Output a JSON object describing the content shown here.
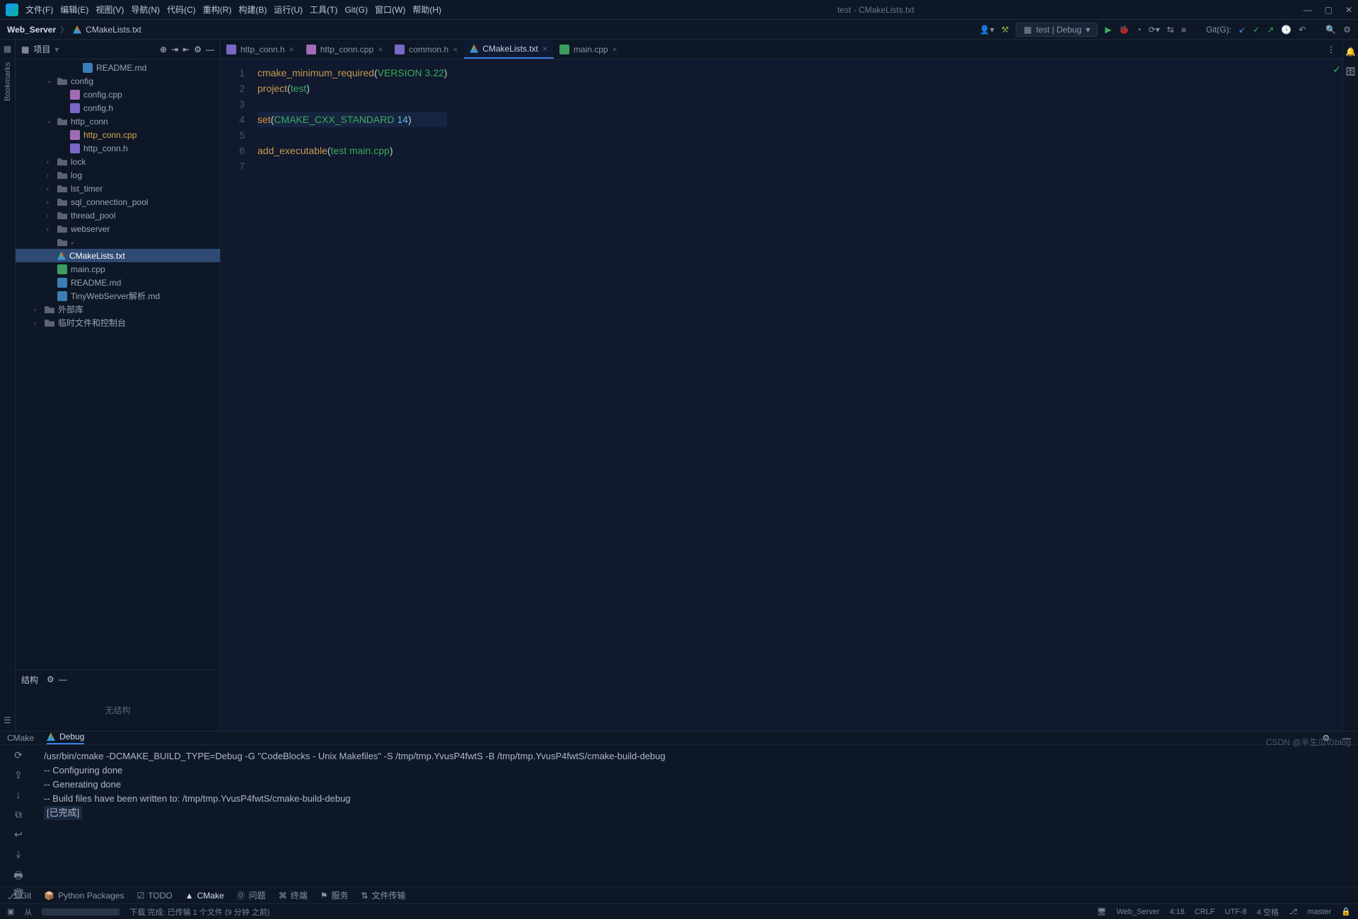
{
  "window": {
    "title": "test - CMakeLists.txt"
  },
  "menu": [
    "文件(F)",
    "编辑(E)",
    "视图(V)",
    "导航(N)",
    "代码(C)",
    "重构(R)",
    "构建(B)",
    "运行(U)",
    "工具(T)",
    "Git(G)",
    "窗口(W)",
    "帮助(H)"
  ],
  "breadcrumbs": {
    "root": "Web_Server",
    "file": "CMakeLists.txt"
  },
  "run_config": {
    "label": "test | Debug"
  },
  "vcs_label": "Git(G):",
  "project_panel": {
    "title": "项目"
  },
  "tree": [
    {
      "depth": 3,
      "icon": "md",
      "label": "README.md",
      "chv": ""
    },
    {
      "depth": 1,
      "icon": "folder",
      "label": "config",
      "chv": "v"
    },
    {
      "depth": 2,
      "icon": "cpp",
      "label": "config.cpp",
      "chv": ""
    },
    {
      "depth": 2,
      "icon": "h",
      "label": "config.h",
      "chv": ""
    },
    {
      "depth": 1,
      "icon": "folder",
      "label": "http_conn",
      "chv": "v"
    },
    {
      "depth": 2,
      "icon": "cpp",
      "label": "http_conn.cpp",
      "chv": "",
      "hl": true
    },
    {
      "depth": 2,
      "icon": "h",
      "label": "http_conn.h",
      "chv": ""
    },
    {
      "depth": 1,
      "icon": "folder",
      "label": "lock",
      "chv": ">"
    },
    {
      "depth": 1,
      "icon": "folder",
      "label": "log",
      "chv": ">"
    },
    {
      "depth": 1,
      "icon": "folder",
      "label": "lst_timer",
      "chv": ">"
    },
    {
      "depth": 1,
      "icon": "folder",
      "label": "sql_connection_pool",
      "chv": ">"
    },
    {
      "depth": 1,
      "icon": "folder",
      "label": "thread_pool",
      "chv": ">"
    },
    {
      "depth": 1,
      "icon": "folder",
      "label": "webserver",
      "chv": ">"
    },
    {
      "depth": 1,
      "icon": "txt",
      "label": "-",
      "chv": ""
    },
    {
      "depth": 1,
      "icon": "cmake",
      "label": "CMakeLists.txt",
      "chv": "",
      "sel": true
    },
    {
      "depth": 1,
      "icon": "main",
      "label": "main.cpp",
      "chv": ""
    },
    {
      "depth": 1,
      "icon": "md",
      "label": "README.md",
      "chv": ""
    },
    {
      "depth": 1,
      "icon": "md",
      "label": "TinyWebServer解析.md",
      "chv": ""
    },
    {
      "depth": 0,
      "icon": "lib",
      "label": "外部库",
      "chv": ">"
    },
    {
      "depth": 0,
      "icon": "scratch",
      "label": "临时文件和控制台",
      "chv": ">"
    }
  ],
  "structure": {
    "title": "结构",
    "empty": "无结构"
  },
  "tabs": [
    {
      "icon": "h",
      "label": "http_conn.h",
      "active": false
    },
    {
      "icon": "cpp",
      "label": "http_conn.cpp",
      "active": false
    },
    {
      "icon": "h",
      "label": "common.h",
      "active": false
    },
    {
      "icon": "cmake",
      "label": "CMakeLists.txt",
      "active": true
    },
    {
      "icon": "main",
      "label": "main.cpp",
      "active": false
    }
  ],
  "code": {
    "lines": [
      {
        "n": 1,
        "seg": [
          [
            "fn",
            "cmake_minimum_required"
          ],
          [
            "par",
            "("
          ],
          [
            "str",
            "VERSION 3.22"
          ],
          [
            "par",
            ")"
          ]
        ]
      },
      {
        "n": 2,
        "seg": [
          [
            "fn",
            "project"
          ],
          [
            "par",
            "("
          ],
          [
            "str",
            "test"
          ],
          [
            "par",
            ")"
          ]
        ]
      },
      {
        "n": 3,
        "seg": []
      },
      {
        "n": 4,
        "seg": [
          [
            "kw",
            "set"
          ],
          [
            "par",
            "("
          ],
          [
            "str",
            "CMAKE_CXX_STANDARD "
          ],
          [
            "num",
            "14"
          ],
          [
            "par",
            ")"
          ]
        ],
        "cur": true
      },
      {
        "n": 5,
        "seg": []
      },
      {
        "n": 6,
        "seg": [
          [
            "fn",
            "add_executable"
          ],
          [
            "par",
            "("
          ],
          [
            "str",
            "test main.cpp"
          ],
          [
            "par",
            ")"
          ]
        ]
      },
      {
        "n": 7,
        "seg": []
      }
    ]
  },
  "bottom": {
    "tabs": [
      "CMake",
      "Debug"
    ],
    "active": 1,
    "console": [
      "/usr/bin/cmake -DCMAKE_BUILD_TYPE=Debug -G \"CodeBlocks - Unix Makefiles\" -S /tmp/tmp.YvusP4fwtS -B /tmp/tmp.YvusP4fwtS/cmake-build-debug",
      "-- Configuring done",
      "-- Generating done",
      "-- Build files have been written to: /tmp/tmp.YvusP4fwtS/cmake-build-debug",
      "",
      "[已完成]"
    ]
  },
  "tool_windows": [
    "Git",
    "Python Packages",
    "TODO",
    "CMake",
    "问题",
    "终端",
    "服务",
    "文件传输"
  ],
  "tool_window_active": 3,
  "status": {
    "left_prefix": "从",
    "left_mid": "下载 完成: 已传输 1 个文件 (9 分钟 之前)",
    "host": "Web_Server",
    "pos": "4:18",
    "eol": "CRLF",
    "enc": "UTF-8",
    "spaces": "4 空格",
    "branch": "master"
  },
  "left_strip": [
    "项目",
    "书签",
    "结构"
  ],
  "right_strip": [
    "通知",
    "数据库"
  ],
  "left_strip_label_bookmarks": "Bookmarks",
  "watermark": "CSDN @半生瓜のblog"
}
